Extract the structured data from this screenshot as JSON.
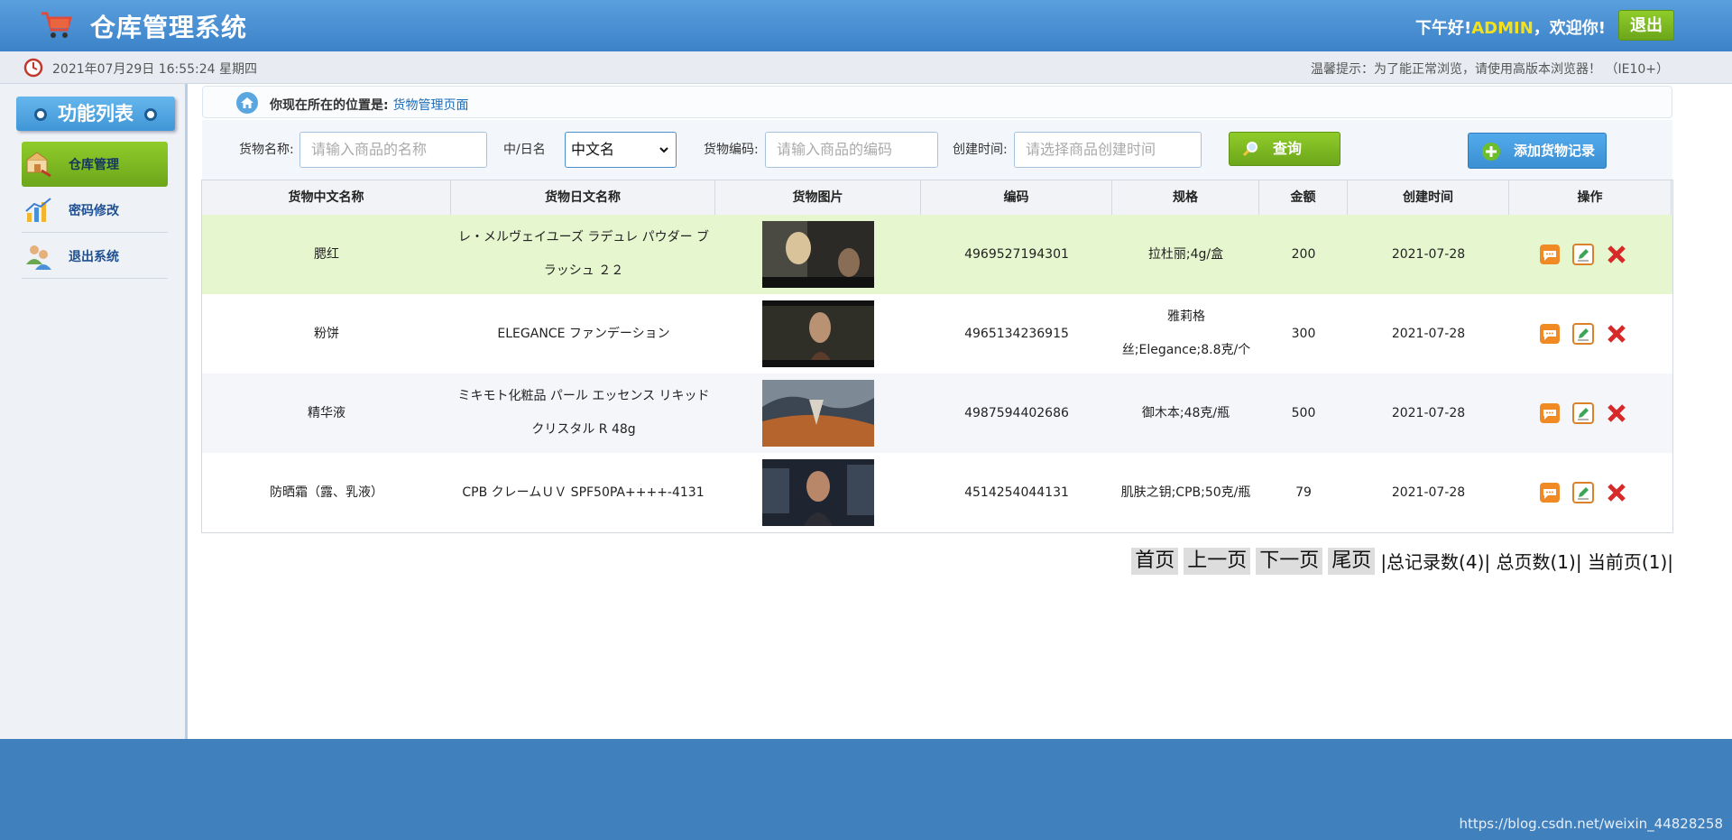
{
  "header": {
    "app_title": "仓库管理系统",
    "greeting_prefix": "下午好!",
    "username": "ADMIN",
    "greeting_suffix": "，欢迎你!",
    "logout_label": "退出"
  },
  "infobar": {
    "datetime": "2021年07月29日 16:55:24 星期四",
    "tip": "温馨提示：为了能正常浏览，请使用高版本浏览器！ （IE10+）"
  },
  "sidebar": {
    "title": "功能列表",
    "items": [
      {
        "label": "仓库管理",
        "icon": "warehouse-icon",
        "active": true
      },
      {
        "label": "密码修改",
        "icon": "password-chart-icon",
        "active": false
      },
      {
        "label": "退出系统",
        "icon": "users-exit-icon",
        "active": false
      }
    ]
  },
  "breadcrumb": {
    "prefix": "你现在所在的位置是:",
    "current": "货物管理页面"
  },
  "search": {
    "name_label": "货物名称:",
    "name_placeholder": "请输入商品的名称",
    "lang_label": "中/日名",
    "lang_value": "中文名",
    "code_label": "货物编码:",
    "code_placeholder": "请输入商品的编码",
    "time_label": "创建时间:",
    "time_placeholder": "请选择商品创建时间",
    "query_label": "查询",
    "add_label": "添加货物记录"
  },
  "table": {
    "columns": [
      "货物中文名称",
      "货物日文名称",
      "货物图片",
      "编码",
      "规格",
      "金额",
      "创建时间",
      "操作"
    ],
    "rows": [
      {
        "cn": "腮红",
        "jp": "レ・メルヴェイユーズ ラデュレ パウダー ブラッシュ ２２",
        "code": "4969527194301",
        "spec": "拉杜丽;4g/盒",
        "amount": "200",
        "date": "2021-07-28"
      },
      {
        "cn": "粉饼",
        "jp": "ELEGANCE ファンデーション",
        "code": "4965134236915",
        "spec": "雅莉格丝;Elegance;8.8克/个",
        "amount": "300",
        "date": "2021-07-28"
      },
      {
        "cn": "精华液",
        "jp": "ミキモト化粧品 パール エッセンス リキッド クリスタル R 48g",
        "code": "4987594402686",
        "spec": "御木本;48克/瓶",
        "amount": "500",
        "date": "2021-07-28"
      },
      {
        "cn": "防晒霜（露、乳液）",
        "jp": "CPB クレームＵＶ SPF50PA++++-4131",
        "code": "4514254044131",
        "spec": "肌肤之钥;CPB;50克/瓶",
        "amount": "79",
        "date": "2021-07-28"
      }
    ]
  },
  "pager": {
    "first": "首页",
    "prev": "上一页",
    "next": "下一页",
    "last": "尾页",
    "total_records": "|总记录数(4)",
    "total_pages": "| 总页数(1)",
    "current_page": "| 当前页(1)|"
  },
  "footer": {
    "watermark": "https://blog.csdn.net/weixin_44828258"
  },
  "colors": {
    "header_blue": "#3b82c8",
    "accent_green": "#7ab41f",
    "username_yellow": "#f4e11b",
    "row_highlight": "#e6f6cf",
    "footer_blue": "#4080bd"
  }
}
